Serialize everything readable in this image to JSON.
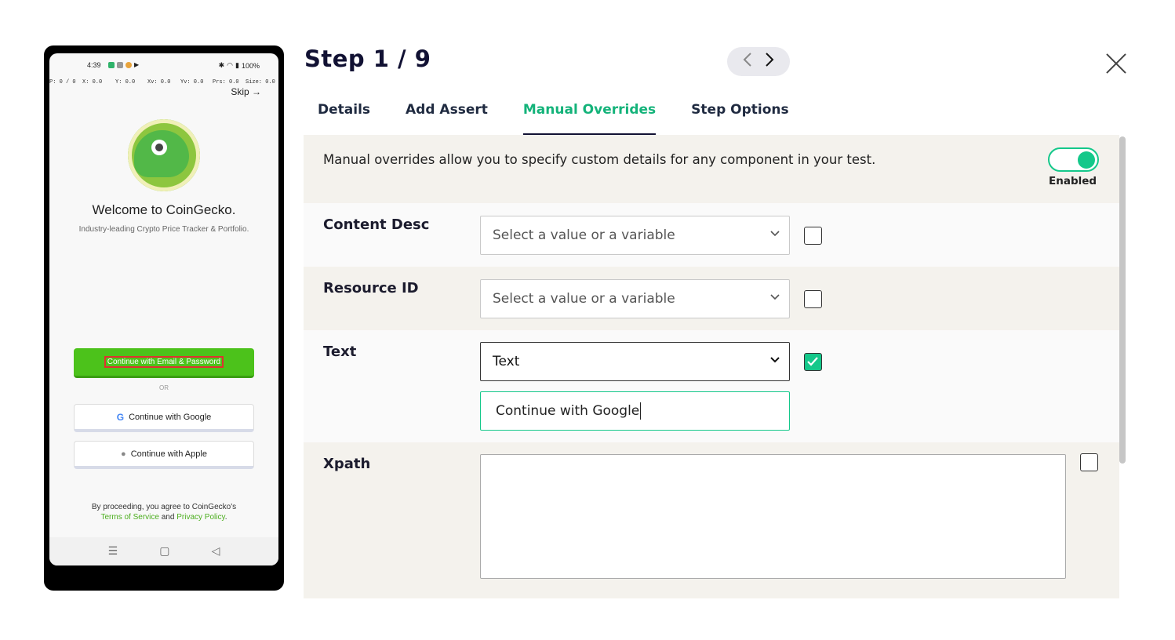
{
  "phone": {
    "status_time": "4:39",
    "status_battery": "100%",
    "pointer": [
      "P: 0 / 0",
      "X: 0.0",
      "Y: 0.0",
      "Xv: 0.0",
      "Yv: 0.0",
      "Prs: 0.0",
      "Size: 0.0"
    ],
    "skip_label": "Skip",
    "welcome": "Welcome to CoinGecko.",
    "tagline": "Industry-leading Crypto Price Tracker & Portfolio.",
    "email_button": "Continue with Email & Password",
    "or_text": "OR",
    "google_button": "Continue with Google",
    "apple_button": "Continue with Apple",
    "legal_prefix": "By proceeding, you agree to CoinGecko's",
    "legal_terms": "Terms of Service",
    "legal_and": "and",
    "legal_privacy": "Privacy Policy",
    "nav_icons": [
      "menu-icon",
      "home-icon",
      "back-icon"
    ]
  },
  "header": {
    "step_title": "Step 1 / 9"
  },
  "tabs": [
    {
      "label": "Details"
    },
    {
      "label": "Add Assert"
    },
    {
      "label": "Manual Overrides",
      "active": true
    },
    {
      "label": "Step Options"
    }
  ],
  "overrides": {
    "info_text": "Manual overrides allow you to specify custom details for any component in your test.",
    "toggle_label": "Enabled",
    "toggle_on": true,
    "rows": [
      {
        "label": "Content Desc",
        "select_value": "Select a value or a variable",
        "checked": false
      },
      {
        "label": "Resource ID",
        "select_value": "Select a value or a variable",
        "checked": false
      },
      {
        "label": "Text",
        "select_value": "Text",
        "checked": true,
        "input_value": "Continue with Google"
      },
      {
        "label": "Xpath",
        "textarea_value": "",
        "checked": false
      }
    ]
  },
  "colors": {
    "accent": "#14c88a",
    "title": "#111133",
    "panel_bg": "#f4f2ed",
    "coingecko_green": "#4cc21b"
  }
}
